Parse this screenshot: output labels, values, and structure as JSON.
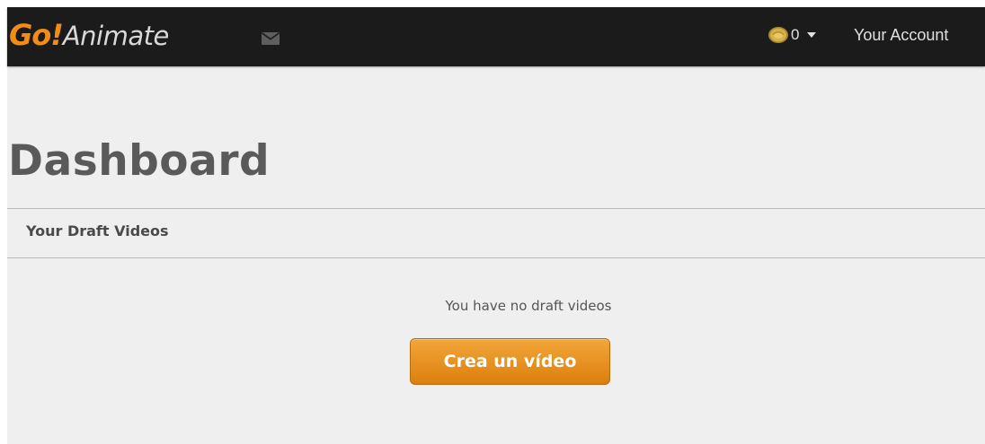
{
  "header": {
    "logo": {
      "go": "Go!",
      "animate": "Animate"
    },
    "icons": {
      "messages": "envelope-icon",
      "coins": "coin-icon",
      "menu": "caret-down-icon"
    },
    "coin_count": "0",
    "account_label": "Your Account"
  },
  "main": {
    "title": "Dashboard",
    "section_title": "Your Draft Videos",
    "empty_message": "You have no draft videos",
    "create_button_label": "Crea un vídeo"
  },
  "colors": {
    "topbar": "#1b1b1b",
    "brand_orange": "#f28c14",
    "page_background": "#efefef",
    "button_gradient_top": "#f3a639",
    "button_gradient_bottom": "#dc7f0e"
  }
}
